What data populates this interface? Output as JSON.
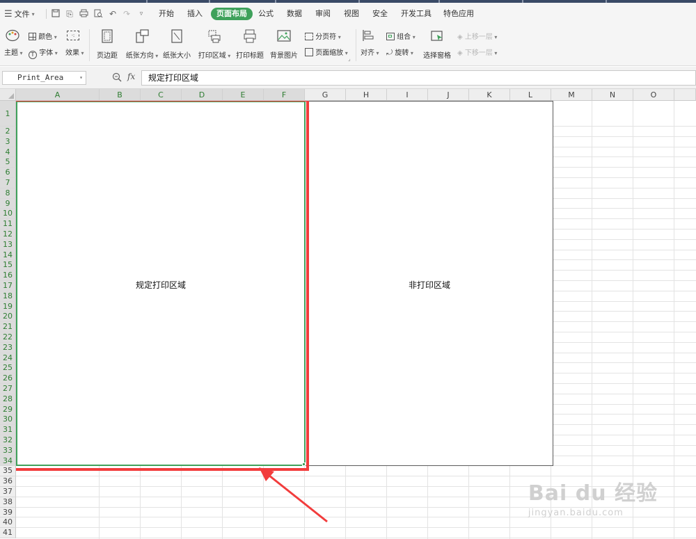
{
  "menu": {
    "file_label": "文件",
    "tabs": [
      "开始",
      "插入",
      "页面布局",
      "公式",
      "数据",
      "审阅",
      "视图",
      "安全",
      "开发工具",
      "特色应用"
    ],
    "active_tab": "页面布局"
  },
  "ribbon": {
    "color_label": "颜色",
    "theme_label": "主题",
    "font_label": "字体",
    "effect_label": "效果",
    "margin_label": "页边距",
    "orientation_label": "纸张方向",
    "size_label": "纸张大小",
    "print_area_label": "打印区域",
    "print_titles_label": "打印标题",
    "background_label": "背景图片",
    "page_break_label": "分页符",
    "page_zoom_label": "页面缩放",
    "align_label": "对齐",
    "group_label": "组合",
    "rotate_label": "旋转",
    "selection_pane_label": "选择窗格",
    "bring_forward_label": "上移一层",
    "send_backward_label": "下移一层"
  },
  "formula_bar": {
    "name_box": "Print_Area",
    "fx_label": "fx",
    "formula_value": "规定打印区域"
  },
  "grid": {
    "columns": [
      "A",
      "B",
      "C",
      "D",
      "E",
      "F",
      "G",
      "H",
      "I",
      "J",
      "K",
      "L",
      "M",
      "N",
      "O"
    ],
    "rows": [
      "1",
      "2",
      "3",
      "4",
      "5",
      "6",
      "7",
      "8",
      "9",
      "10",
      "11",
      "12",
      "13",
      "14",
      "15",
      "16",
      "17",
      "18",
      "19",
      "20",
      "21",
      "22",
      "23",
      "24",
      "25",
      "26",
      "27",
      "28",
      "29",
      "30",
      "31",
      "32",
      "33",
      "34",
      "35",
      "36",
      "37",
      "38",
      "39",
      "40",
      "41"
    ],
    "selected_columns": [
      "A",
      "B",
      "C",
      "D",
      "E",
      "F"
    ],
    "selected_rows_last": 34
  },
  "sheet": {
    "print_area_text": "规定打印区域",
    "non_print_area_text": "非打印区域"
  },
  "watermark": {
    "main": "Bai du 经验",
    "sub": "jingyan.baidu.com"
  },
  "colors": {
    "accent_green": "#3fa15b",
    "annotation_red": "#f23c3c"
  }
}
